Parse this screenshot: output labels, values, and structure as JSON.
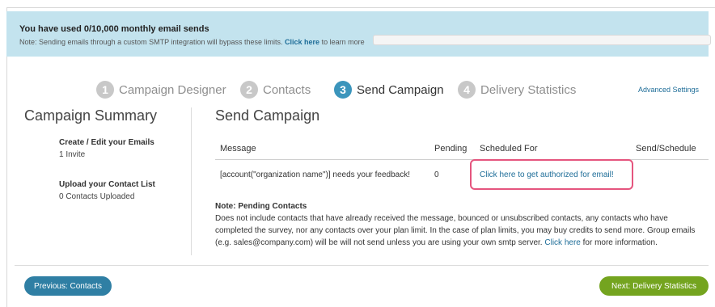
{
  "banner": {
    "title": "You have used 0/10,000 monthly email sends",
    "note_text": "Note: Sending emails through a custom SMTP integration will bypass these limits.",
    "note_link": "Click here",
    "note_tail": "to learn more",
    "usage_fraction": 0
  },
  "steps": [
    {
      "number": "1",
      "label": "Campaign Designer",
      "active": false
    },
    {
      "number": "2",
      "label": "Contacts",
      "active": false
    },
    {
      "number": "3",
      "label": "Send Campaign",
      "active": true
    },
    {
      "number": "4",
      "label": "Delivery Statistics",
      "active": false
    }
  ],
  "advanced_settings": "Advanced Settings",
  "summary": {
    "title": "Campaign Summary",
    "emails_heading": "Create / Edit your Emails",
    "emails_value": "1 Invite",
    "contacts_heading": "Upload your Contact List",
    "contacts_value": "0 Contacts Uploaded"
  },
  "send": {
    "title": "Send Campaign",
    "columns": [
      "Message",
      "Pending",
      "Scheduled For",
      "Send/Schedule"
    ],
    "row": {
      "message": "[account(\"organization name\")] needs your feedback!",
      "pending": "0",
      "scheduled_link": "Click here to get authorized for email!"
    }
  },
  "note": {
    "heading": "Note: Pending Contacts",
    "body": "Does not include contacts that have already received the message, bounced or unsubscribed contacts, any contacts who have completed the survey, nor any contacts over your plan limit. In the case of plan limits, you may buy credits to send more. Group emails (e.g. sales@company.com) will be will not send unless you are using your own smtp server.",
    "link": "Click here",
    "tail": "for more information."
  },
  "buttons": {
    "previous": "Previous: Contacts",
    "next": "Next: Delivery Statistics"
  },
  "colors": {
    "banner_bg": "#c3e3ee",
    "link": "#1e6d98",
    "active_step": "#3b95bc",
    "highlight_border": "#e5557e",
    "prev_button": "#2f7fa4",
    "next_button": "#74a41f"
  }
}
